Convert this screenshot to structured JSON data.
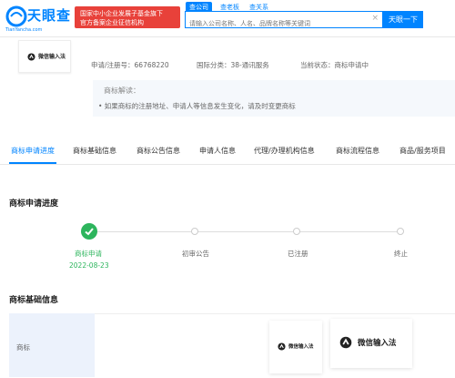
{
  "header": {
    "logo_text": "天眼查",
    "logo_sub": "TianYancha.com",
    "gov_badge_line1": "国家中小企业发展子基金旗下",
    "gov_badge_line2": "官方备案企业征信机构",
    "tabs": [
      "查公司",
      "查老板",
      "查关系"
    ],
    "search_placeholder": "请输入公司名称、人名、品牌名称等关键词",
    "search_button": "天眼一下",
    "accent_color": "#0084ff",
    "badge_color": "#e8413a"
  },
  "trademark": {
    "name": "微信输入法",
    "reg_no": "申请/注册号：66768220",
    "intl_class": "国际分类：38-通讯服务",
    "status": "当前状态：商标申请中",
    "explain_title": "商标解读：",
    "explain_body": "• 如果商标的注册地址、申请人等信息发生变化，请及时变更商标"
  },
  "tabs": [
    "商标申请进度",
    "商标基础信息",
    "商标公告信息",
    "申请人信息",
    "代理/办理机构信息",
    "商标流程信息",
    "商品/服务项目"
  ],
  "progress": {
    "title": "商标申请进度",
    "steps": [
      {
        "label": "商标申请",
        "date": "2022-08-23",
        "done": true
      },
      {
        "label": "初审公告",
        "done": false
      },
      {
        "label": "已注册",
        "done": false
      },
      {
        "label": "终止",
        "done": false
      }
    ]
  },
  "basic_info": {
    "title": "商标基础信息",
    "label": "商标",
    "image_text": "微信输入法"
  }
}
